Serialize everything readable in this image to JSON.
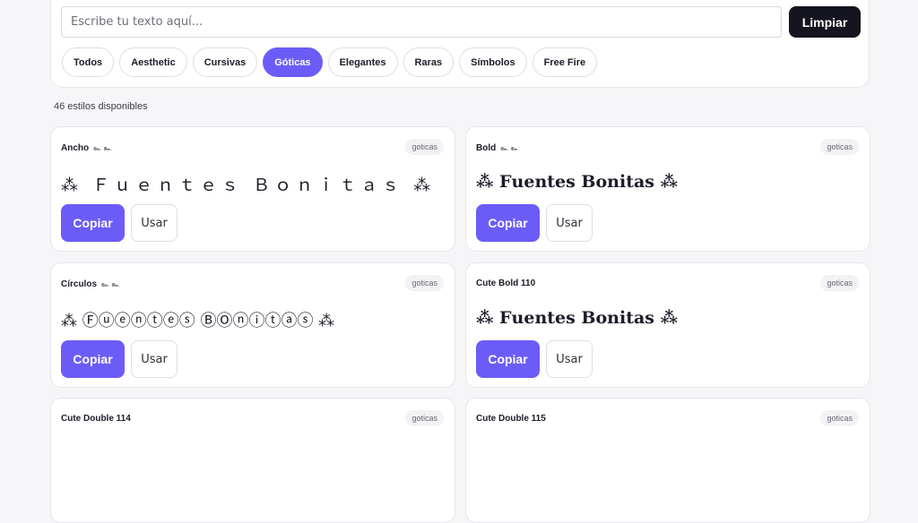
{
  "search": {
    "placeholder": "Escribe tu texto aquí...",
    "clear_label": "Limpiar"
  },
  "categories": [
    "Todos",
    "Aesthetic",
    "Cursivas",
    "Góticas",
    "Elegantes",
    "Raras",
    "Símbolos",
    "Free Fire"
  ],
  "active_category": "Góticas",
  "styles_count": "46 estilos disponibles",
  "cards": [
    {
      "title": "Ancho",
      "ornament": "๛ ๛",
      "tag": "goticas",
      "preview": "⁂ Ｆｕｅｎｔｅｓ Ｂｏｎｉｔａｓ ⁂",
      "copy": "Copiar",
      "use": "Usar"
    },
    {
      "title": "Bold",
      "ornament": "๛ ๛",
      "tag": "goticas",
      "preview": "⁂ 𝐅𝐮𝐞𝐧𝐭𝐞𝐬 𝐁𝐨𝐧𝐢𝐭𝐚𝐬 ⁂",
      "copy": "Copiar",
      "use": "Usar"
    },
    {
      "title": "Círculos",
      "ornament": "๛ ๛",
      "tag": "goticas",
      "preview": "⁂ Ⓕⓤⓔⓝⓣⓔⓢ ⒷⓄⓝⓘⓣⓐⓢ ⁂",
      "copy": "Copiar",
      "use": "Usar"
    },
    {
      "title": "Cute Bold 110",
      "ornament": "",
      "tag": "goticas",
      "preview": "⁂ 𝐅𝐮𝐞𝐧𝐭𝐞𝐬 𝐁𝐨𝐧𝐢𝐭𝐚𝐬 ⁂",
      "copy": "Copiar",
      "use": "Usar"
    },
    {
      "title": "Cute Double 114",
      "ornament": "",
      "tag": "goticas"
    },
    {
      "title": "Cute Double 115",
      "ornament": "",
      "tag": "goticas"
    }
  ],
  "colors": {
    "accent": "#6c5cf7",
    "dark_button": "#15151f"
  }
}
